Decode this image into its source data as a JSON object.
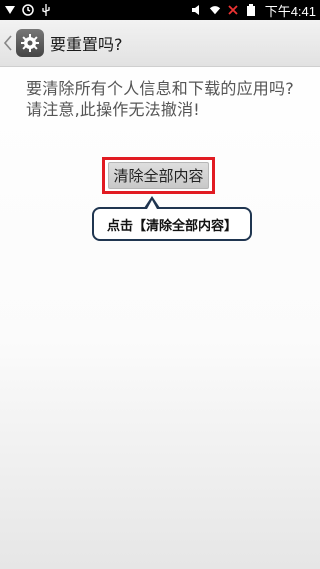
{
  "status_bar": {
    "time": "下午4:41",
    "left_icons": [
      "notification-icon",
      "sync-icon",
      "usb-icon"
    ],
    "right_icons": [
      "vibrate-icon",
      "wifi-icon",
      "no-signal-icon",
      "battery-icon"
    ]
  },
  "action_bar": {
    "title": "要重置吗?"
  },
  "message": "要清除所有个人信息和下载的应用吗?请注意,此操作无法撤消!",
  "erase_button": {
    "label": "清除全部内容"
  },
  "callout": {
    "text": "点击【清除全部内容】"
  },
  "colors": {
    "highlight_border": "#e11b22",
    "callout_border": "#1f3550"
  }
}
